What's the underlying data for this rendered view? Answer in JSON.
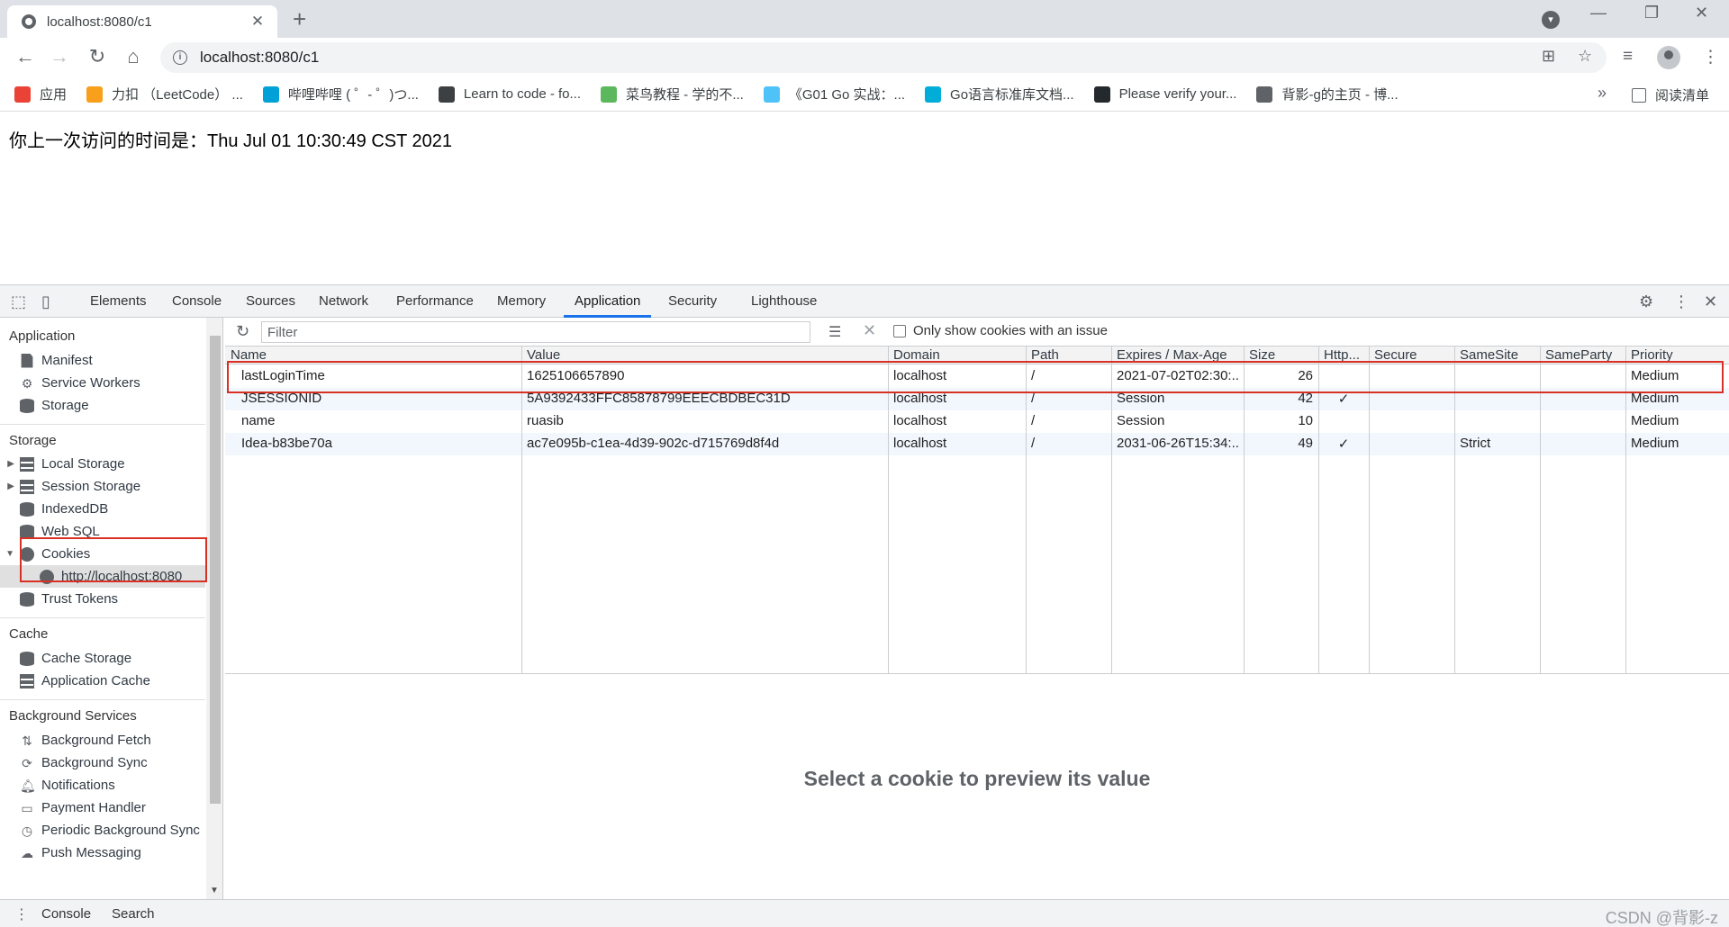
{
  "browser": {
    "tab_title": "localhost:8080/c1",
    "tab_close": "✕",
    "new_tab": "+",
    "url": "localhost:8080/c1",
    "bookmarks": [
      {
        "label": "应用",
        "color": "#ea4335"
      },
      {
        "label": "力扣 （LeetCode） ...",
        "color": "#f89f1b"
      },
      {
        "label": "哔哩哔哩 ( ゜- ゜)つ...",
        "color": "#00a1d6"
      },
      {
        "label": "Learn to code - fo...",
        "color": "#3c4043"
      },
      {
        "label": "菜鸟教程 - 学的不...",
        "color": "#5cb85c"
      },
      {
        "label": "《G01 Go 实战：...",
        "color": "#4fc3f7"
      },
      {
        "label": "Go语言标准库文档...",
        "color": "#00add8"
      },
      {
        "label": "Please verify your...",
        "color": "#24292e"
      },
      {
        "label": "背影-g的主页 - 博...",
        "color": "#5f6368"
      }
    ],
    "bookmarks_more": "»",
    "reading_list": "阅读清单"
  },
  "page": {
    "text": "你上一次访问的时间是：Thu Jul 01 10:30:49 CST 2021"
  },
  "devtools": {
    "tabs": [
      "Elements",
      "Console",
      "Sources",
      "Network",
      "Performance",
      "Memory",
      "Application",
      "Security",
      "Lighthouse"
    ],
    "active_tab": "Application",
    "sidebar": {
      "application_header": "Application",
      "application_items": [
        "Manifest",
        "Service Workers",
        "Storage"
      ],
      "storage_header": "Storage",
      "storage_items": [
        "Local Storage",
        "Session Storage",
        "IndexedDB",
        "Web SQL",
        "Cookies"
      ],
      "cookie_origin": "http://localhost:8080",
      "trust_tokens": "Trust Tokens",
      "cache_header": "Cache",
      "cache_items": [
        "Cache Storage",
        "Application Cache"
      ],
      "bg_header": "Background Services",
      "bg_items": [
        "Background Fetch",
        "Background Sync",
        "Notifications",
        "Payment Handler",
        "Periodic Background Sync",
        "Push Messaging"
      ]
    },
    "cookies": {
      "filter_placeholder": "Filter",
      "only_issues_label": "Only show cookies with an issue",
      "columns": [
        "Name",
        "Value",
        "Domain",
        "Path",
        "Expires / Max-Age",
        "Size",
        "Http...",
        "Secure",
        "SameSite",
        "SameParty",
        "Priority"
      ],
      "rows": [
        [
          "lastLoginTime",
          "1625106657890",
          "localhost",
          "/",
          "2021-07-02T02:30:...",
          "26",
          "",
          "",
          "",
          "",
          "Medium"
        ],
        [
          "JSESSIONID",
          "5A9392433FFC85878799EEECBDBEC31D",
          "localhost",
          "/",
          "Session",
          "42",
          "✓",
          "",
          "",
          "",
          "Medium"
        ],
        [
          "name",
          "ruasib",
          "localhost",
          "/",
          "Session",
          "10",
          "",
          "",
          "",
          "",
          "Medium"
        ],
        [
          "Idea-b83be70a",
          "ac7e095b-c1ea-4d39-902c-d715769d8f4d",
          "localhost",
          "/",
          "2031-06-26T15:34:...",
          "49",
          "✓",
          "",
          "Strict",
          "",
          "Medium"
        ]
      ],
      "preview_text": "Select a cookie to preview its value"
    },
    "drawer": {
      "tabs": [
        "Console",
        "Search"
      ]
    },
    "watermark": "CSDN @背影-z"
  }
}
